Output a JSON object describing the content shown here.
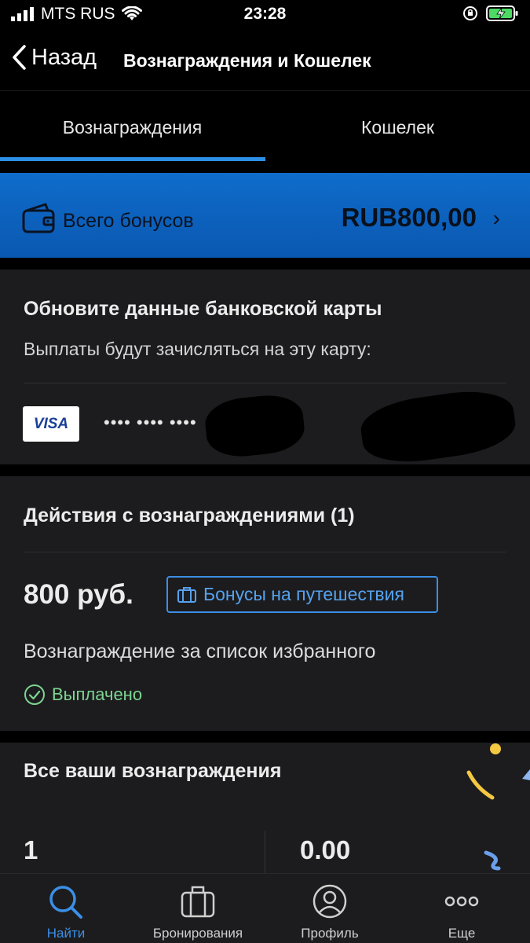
{
  "status_bar": {
    "carrier": "MTS RUS",
    "time": "23:28"
  },
  "nav": {
    "back_label": "Назад",
    "title": "Вознаграждения и Кошелек"
  },
  "tabs": [
    {
      "label": "Вознаграждения",
      "selected": true
    },
    {
      "label": "Кошелек",
      "selected": false
    }
  ],
  "bonus_banner": {
    "label": "Всего бонусов",
    "amount": "RUB800,00",
    "icon": "wallet-icon",
    "chevron": "›"
  },
  "bank_card": {
    "heading": "Обновите данные банковской карты",
    "subtext": "Выплаты будут зачисляться на эту карту:",
    "brand": "VISA",
    "masked_number": "•••• •••• ••••"
  },
  "reward_actions": {
    "heading": "Действия с вознаграждениями (1)",
    "amount": "800 руб.",
    "tag_label": "Бонусы на путешествия",
    "description": "Вознаграждение за список избранного",
    "status": "Выплачено"
  },
  "all_rewards": {
    "heading": "Все ваши вознаграждения",
    "count": "1",
    "total": "0.00"
  },
  "bottom_tabs": [
    {
      "label": "Найти",
      "icon": "search-icon",
      "active": true
    },
    {
      "label": "Бронирования",
      "icon": "suitcase-icon",
      "active": false
    },
    {
      "label": "Профиль",
      "icon": "profile-icon",
      "active": false
    },
    {
      "label": "Еще",
      "icon": "more-icon",
      "active": false
    }
  ],
  "colors": {
    "accent": "#2e8fe6",
    "banner": "#0f6ccb",
    "paid_green": "#7ed491",
    "card_bg": "#1c1c1e"
  }
}
